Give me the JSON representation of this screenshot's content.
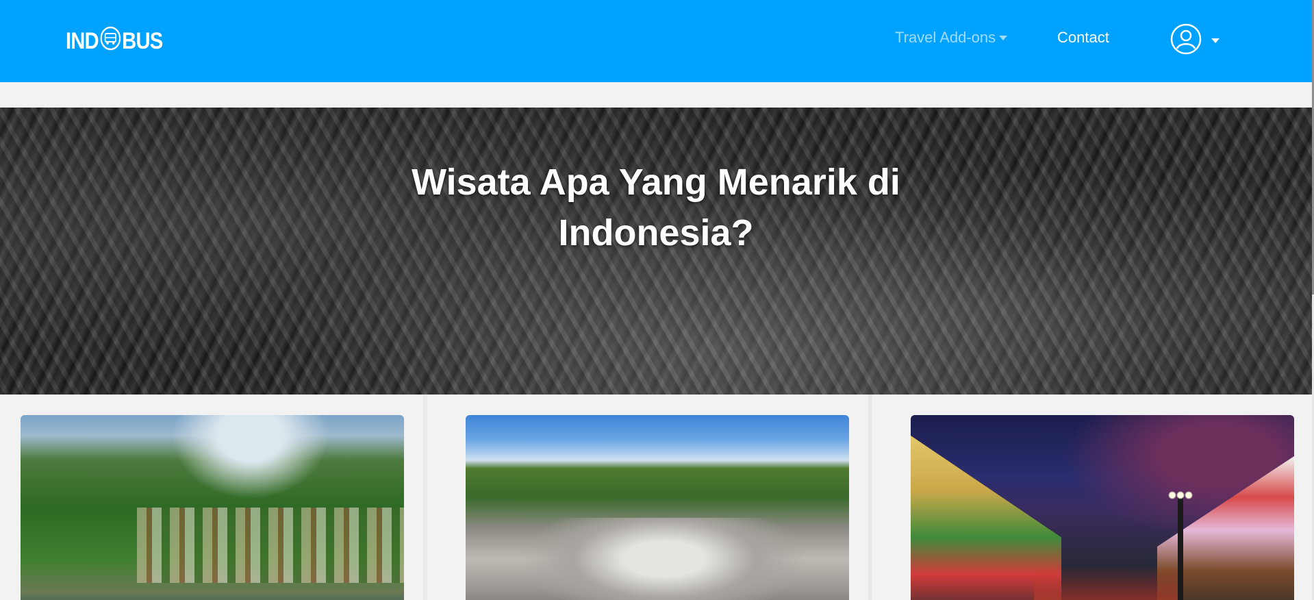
{
  "brand": {
    "logo_text_left": "IND",
    "logo_text_right": "BUS",
    "logo_icon": "bus-globe-icon"
  },
  "nav": {
    "travel_addons_label": "Travel Add-ons",
    "contact_label": "Contact",
    "user_icon": "user-circle-icon"
  },
  "colors": {
    "navbar_bg": "#00a2ff",
    "page_bg": "#f2f2f2",
    "hero_text": "#ffffff"
  },
  "hero": {
    "title": "Wisata Apa Yang Menarik di Indonesia?"
  },
  "cards": [
    {
      "image": "lakeside-town-mountain-photo"
    },
    {
      "image": "volcano-crater-photo"
    },
    {
      "image": "night-street-shops-photo"
    }
  ]
}
